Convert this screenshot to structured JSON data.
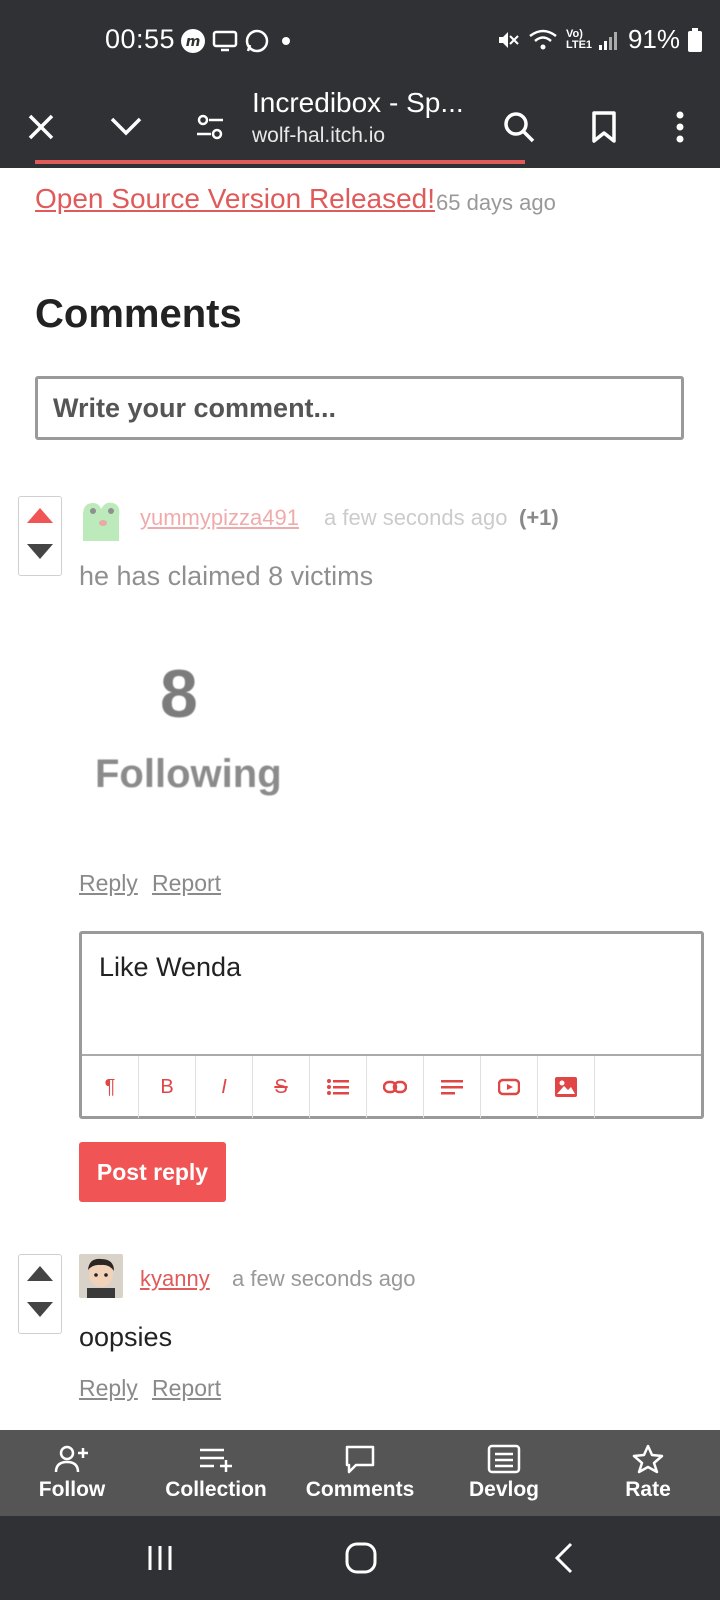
{
  "status_bar": {
    "time": "00:55",
    "battery": "91%",
    "network_label": "Vo) LTE1"
  },
  "browser": {
    "title": "Incredibox - Sp...",
    "url": "wolf-hal.itch.io"
  },
  "devlog": {
    "link_text": "Open Source Version Released!",
    "ago": "65 days ago"
  },
  "comments_section": {
    "heading": "Comments",
    "input_placeholder": "Write your comment..."
  },
  "comments": [
    {
      "username": "yummypizza491",
      "time": "a few seconds ago",
      "score": "(+1)",
      "body": "he has claimed 8 victims",
      "image_number": "8",
      "image_label": "Following",
      "reply_label": "Reply",
      "report_label": "Report"
    },
    {
      "username": "kyanny",
      "time": "a few seconds ago",
      "body": "oopsies",
      "reply_label": "Reply",
      "report_label": "Report"
    }
  ],
  "reply_editor": {
    "value": "Like Wenda",
    "toolbar_icons": [
      "paragraph-icon",
      "bold-icon",
      "italic-icon",
      "strikethrough-icon",
      "list-icon",
      "link-icon",
      "align-icon",
      "video-icon",
      "image-icon"
    ],
    "toolbar_glyphs": [
      "¶",
      "B",
      "I",
      "S"
    ],
    "post_label": "Post reply"
  },
  "tabbar": {
    "follow": "Follow",
    "collection": "Collection",
    "comments": "Comments",
    "devlog": "Devlog",
    "rate": "Rate"
  },
  "colors": {
    "accent": "#f05454",
    "link": "#e05a5a",
    "dark_chrome": "#2f3134",
    "tabbar": "#555555"
  }
}
